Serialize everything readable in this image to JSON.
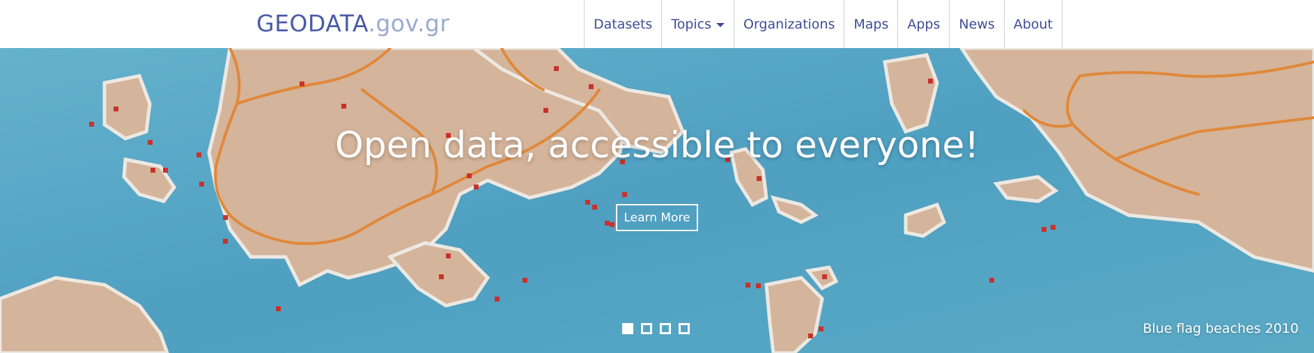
{
  "header": {
    "logo_main": "GEODATA",
    "logo_suffix": ".gov.gr"
  },
  "nav": {
    "items": [
      {
        "label": "Datasets"
      },
      {
        "label": "Topics",
        "dropdown_icon": "caret-down-icon"
      },
      {
        "label": "Organizations"
      },
      {
        "label": "Maps"
      },
      {
        "label": "Apps"
      },
      {
        "label": "News"
      },
      {
        "label": "About"
      }
    ]
  },
  "hero": {
    "headline": "Open data, accessible to everyone!",
    "button_label": "Learn More",
    "caption": "Blue flag beaches 2010",
    "slides_total": 4,
    "active_slide": 1,
    "colors": {
      "sea": "#58a8c7",
      "land": "#d4b49a",
      "road": "#e0883a",
      "marker": "#c8322b",
      "coast": "#e8e6e2"
    }
  }
}
